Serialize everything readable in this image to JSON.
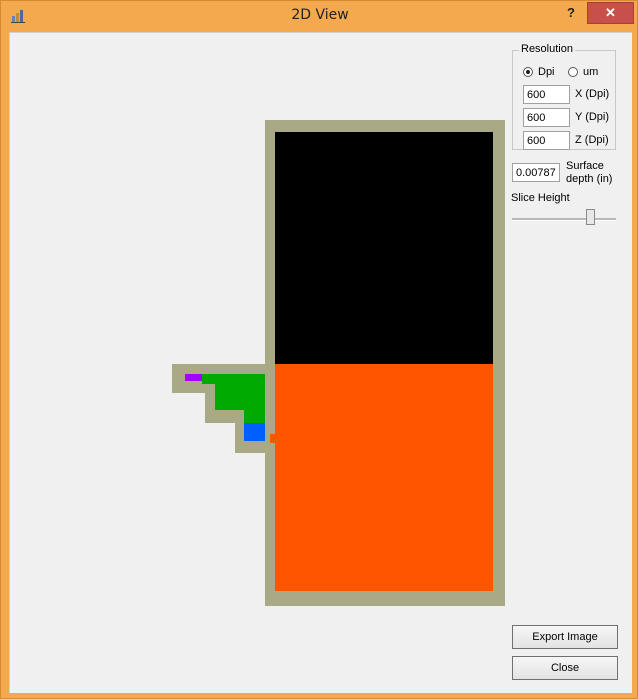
{
  "window": {
    "title": "2D View",
    "help_label": "?",
    "close_glyph": "✕"
  },
  "resolution": {
    "group_label": "Resolution",
    "options": [
      {
        "label": "Dpi",
        "selected": true
      },
      {
        "label": "um",
        "selected": false
      }
    ],
    "x": {
      "value": "600",
      "label": "X (Dpi)"
    },
    "y": {
      "value": "600",
      "label": "Y (Dpi)"
    },
    "z": {
      "value": "600",
      "label": "Z (Dpi)"
    }
  },
  "surface_depth": {
    "value": "0.00787",
    "label_line1": "Surface",
    "label_line2": "depth (in)"
  },
  "slice_height": {
    "label": "Slice Height",
    "level": 0.78
  },
  "buttons": {
    "export": "Export Image",
    "close": "Close"
  },
  "colors": {
    "outline": "#a9a985",
    "void": "#000000",
    "body": "#ff5500",
    "green": "#00aa00",
    "blue": "#0060ff",
    "purple": "#a000ff"
  }
}
